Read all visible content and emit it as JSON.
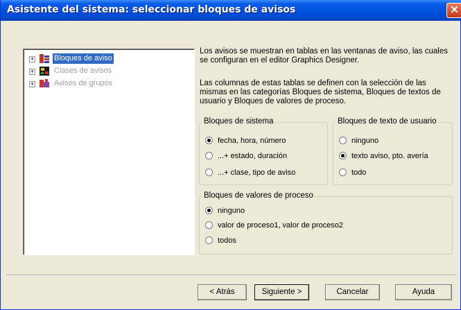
{
  "window": {
    "title": "Asistente del sistema: seleccionar bloques de avisos",
    "close_glyph": "✕"
  },
  "tree": {
    "items": [
      {
        "label": "Bloques de aviso",
        "icon": "message-blocks-icon",
        "selected": true
      },
      {
        "label": "Clases de avisos",
        "icon": "message-classes-icon",
        "selected": false
      },
      {
        "label": "Avisos de grupos",
        "icon": "group-messages-icon",
        "selected": false
      }
    ],
    "expander_glyph": "+"
  },
  "description": {
    "p1": "Los avisos se muestran en tablas en las ventanas de aviso, las cuales se configuran en el editor Graphics Designer.",
    "p2": "Las columnas de estas tablas se definen con la selección de las mismas en las categorías Bloques de sistema, Bloques de textos de usuario y Bloques de valores de proceso."
  },
  "system_blocks": {
    "title": "Bloques de sistema",
    "options": [
      {
        "label": "fecha, hora, número",
        "checked": true
      },
      {
        "label": "...+ estado, duración",
        "checked": false
      },
      {
        "label": "...+ clase, tipo de aviso",
        "checked": false
      }
    ]
  },
  "user_text_blocks": {
    "title": "Bloques de texto de usuario",
    "options": [
      {
        "label": "ninguno",
        "checked": false
      },
      {
        "label": "texto aviso, pto. avería",
        "checked": true
      },
      {
        "label": "todo",
        "checked": false
      }
    ]
  },
  "process_value_blocks": {
    "title": "Bloques de valores de proceso",
    "options": [
      {
        "label": "ninguno",
        "checked": true
      },
      {
        "label": "valor de proceso1, valor de proceso2",
        "checked": false
      },
      {
        "label": "todos",
        "checked": false
      }
    ]
  },
  "buttons": {
    "back": "< Atrás",
    "next": "Siguiente >",
    "cancel": "Cancelar",
    "help": "Ayuda"
  },
  "colors": {
    "titlebar": "#0052de",
    "selection": "#316ac5",
    "dialog": "#ece9d8"
  }
}
